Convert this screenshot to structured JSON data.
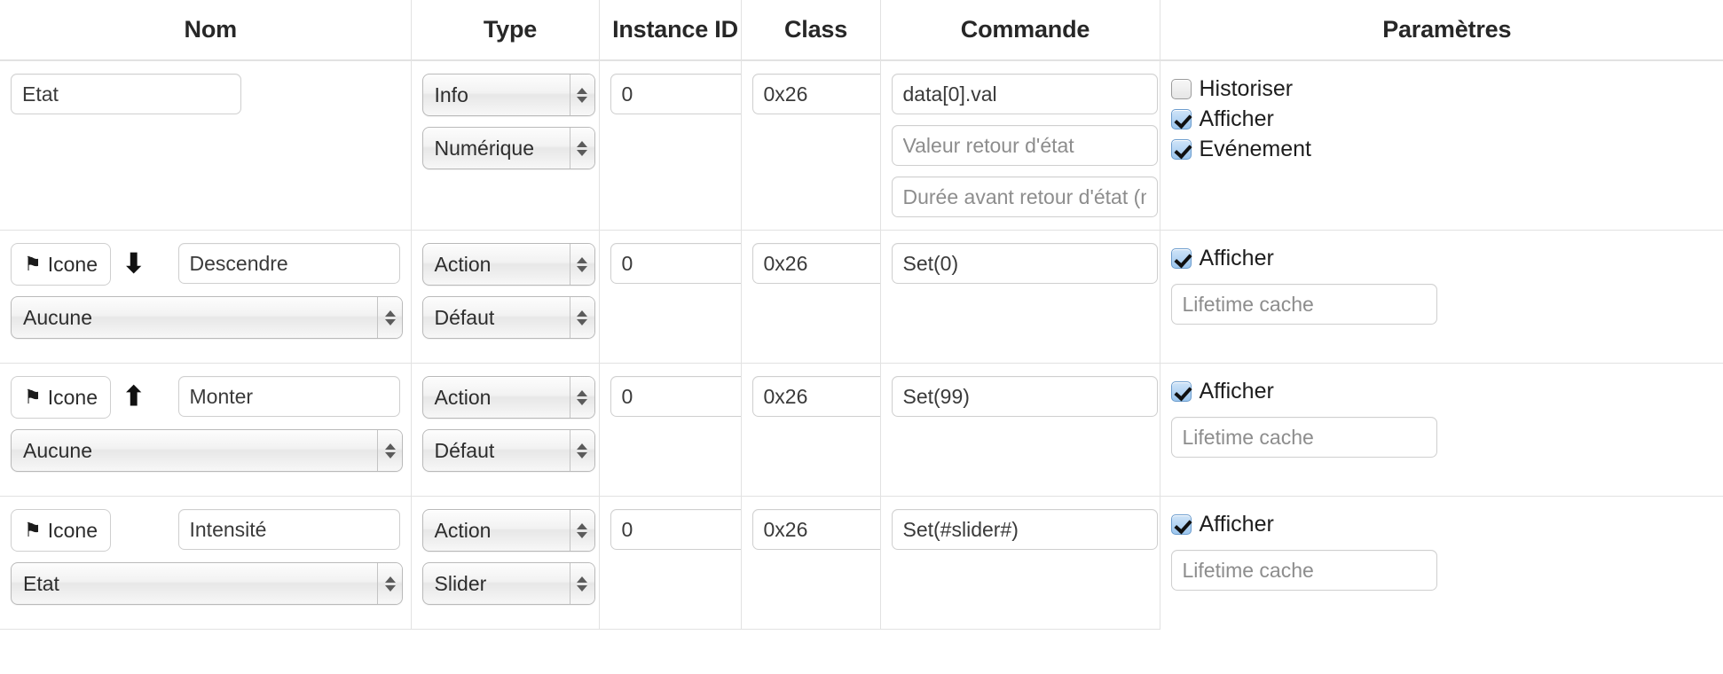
{
  "table": {
    "columns": [
      {
        "key": "nom",
        "label": "Nom"
      },
      {
        "key": "type",
        "label": "Type"
      },
      {
        "key": "inst",
        "label": "Instance ID"
      },
      {
        "key": "class",
        "label": "Class"
      },
      {
        "key": "cmd",
        "label": "Commande"
      },
      {
        "key": "params",
        "label": "Paramètres"
      }
    ],
    "rows": [
      {
        "nom": {
          "value": "Etat"
        },
        "type": {
          "kind": "Info",
          "subtype": "Numérique"
        },
        "instance_id": "0",
        "class": "0x26",
        "commande": {
          "value": "data[0].val",
          "retour_placeholder": "Valeur retour d'état",
          "duree_placeholder": "Durée avant retour d'état (min)"
        },
        "parametres": {
          "checkboxes": [
            {
              "label": "Historiser",
              "checked": false
            },
            {
              "label": "Afficher",
              "checked": true
            },
            {
              "label": "Evénement",
              "checked": true
            }
          ]
        }
      },
      {
        "nom": {
          "icon_button": "Icone",
          "flag_glyph": "⚑",
          "arrow_glyph": "⬇",
          "label": "Descendre",
          "select": "Aucune"
        },
        "type": {
          "kind": "Action",
          "subtype": "Défaut"
        },
        "instance_id": "0",
        "class": "0x26",
        "commande": {
          "value": "Set(0)"
        },
        "parametres": {
          "checkboxes": [
            {
              "label": "Afficher",
              "checked": true
            }
          ],
          "cache_placeholder": "Lifetime cache"
        }
      },
      {
        "nom": {
          "icon_button": "Icone",
          "flag_glyph": "⚑",
          "arrow_glyph": "⬆",
          "label": "Monter",
          "select": "Aucune"
        },
        "type": {
          "kind": "Action",
          "subtype": "Défaut"
        },
        "instance_id": "0",
        "class": "0x26",
        "commande": {
          "value": "Set(99)"
        },
        "parametres": {
          "checkboxes": [
            {
              "label": "Afficher",
              "checked": true
            }
          ],
          "cache_placeholder": "Lifetime cache"
        }
      },
      {
        "nom": {
          "icon_button": "Icone",
          "flag_glyph": "⚑",
          "arrow_glyph": "",
          "label": "Intensité",
          "select": "Etat"
        },
        "type": {
          "kind": "Action",
          "subtype": "Slider"
        },
        "instance_id": "0",
        "class": "0x26",
        "commande": {
          "value": "Set(#slider#)"
        },
        "parametres": {
          "checkboxes": [
            {
              "label": "Afficher",
              "checked": true
            }
          ],
          "cache_placeholder": "Lifetime cache"
        }
      }
    ]
  },
  "colors": {
    "border": "#e2e2e2",
    "text": "#272727",
    "placeholder": "#8d8d8d",
    "checkbox_checked": "#9cc6ee"
  }
}
